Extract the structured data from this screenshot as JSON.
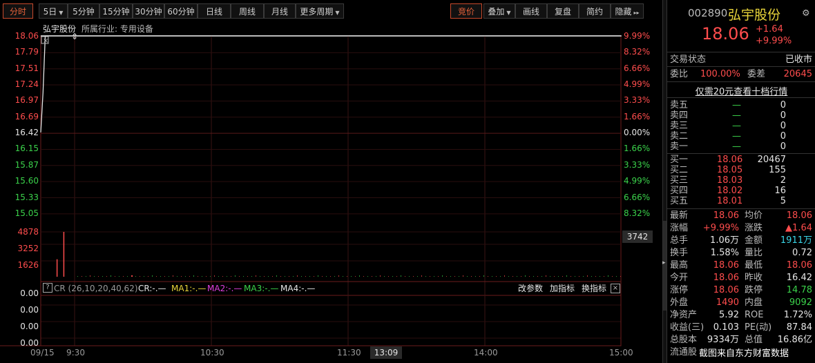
{
  "toolbar": {
    "tabs": [
      "分时",
      "5日",
      "5分钟",
      "15分钟",
      "30分钟",
      "60分钟",
      "日线",
      "周线",
      "月线",
      "更多周期"
    ],
    "right": [
      "竞价",
      "叠加",
      "画线",
      "复盘",
      "简约",
      "隐藏"
    ],
    "more_arrow": "▸▸"
  },
  "chart": {
    "stock_name": "弘宇股份",
    "industry": "所属行业: 专用设备",
    "price_labels": [
      "18.06",
      "17.79",
      "17.51",
      "17.24",
      "16.97",
      "16.69",
      "16.42",
      "16.15",
      "15.87",
      "15.60",
      "15.33",
      "15.05"
    ],
    "pct_labels": [
      "9.99%",
      "8.32%",
      "6.66%",
      "4.99%",
      "3.33%",
      "1.66%",
      "0.00%",
      "1.66%",
      "3.33%",
      "4.99%",
      "6.66%",
      "8.32%"
    ],
    "vol_labels": [
      "4878",
      "3252",
      "1626"
    ],
    "vol_marker": "3742",
    "indicator": {
      "name": "CR (26,10,20,40,62)",
      "cr": "CR:-.—",
      "ma1": "MA1:-.—",
      "ma2": "MA2:-.—",
      "ma3": "MA3:-.—",
      "ma4": "MA4:-.—",
      "actions": [
        "改参数",
        "加指标",
        "换指标"
      ],
      "y_labels": [
        "0.00",
        "0.00",
        "0.00",
        "0.00",
        "0.00"
      ]
    },
    "x_labels": [
      "09/15",
      "9:30",
      "10:30",
      "11:30",
      "13:09",
      "14:00",
      "15:00"
    ],
    "colors": {
      "up": "#ff4d4d",
      "down": "#3bd34b",
      "ma2": "#e040e0",
      "ma1": "#e8d43a"
    }
  },
  "chart_data": {
    "type": "line",
    "title": "弘宇股份",
    "ylim": [
      15.05,
      18.06
    ],
    "price_line": [
      {
        "x": "09:15",
        "y": 16.42
      },
      {
        "x": "09:16",
        "y": 17.1
      },
      {
        "x": "09:17",
        "y": 18.06
      },
      {
        "x": "15:00",
        "y": 18.06
      }
    ],
    "volume": [
      {
        "x": "09:22",
        "v": 1900
      },
      {
        "x": "09:25",
        "v": 4878
      },
      {
        "x": "09:55",
        "v": 150
      }
    ]
  },
  "quote": {
    "code": "002890",
    "name": "弘宇股份",
    "price": "18.06",
    "change": "+1.64",
    "pct": "+9.99%",
    "status_label": "交易状态",
    "status_value": "已收市",
    "weibi_label": "委比",
    "weibi_value": "100.00%",
    "weicha_label": "委差",
    "weicha_value": "20645",
    "link": "仅需20元查看十档行情",
    "asks": [
      {
        "label": "卖五",
        "price": "—",
        "vol": "0"
      },
      {
        "label": "卖四",
        "price": "—",
        "vol": "0"
      },
      {
        "label": "卖三",
        "price": "—",
        "vol": "0"
      },
      {
        "label": "卖二",
        "price": "—",
        "vol": "0"
      },
      {
        "label": "卖一",
        "price": "—",
        "vol": "0"
      }
    ],
    "bids": [
      {
        "label": "买一",
        "price": "18.06",
        "vol": "20467"
      },
      {
        "label": "买二",
        "price": "18.05",
        "vol": "155"
      },
      {
        "label": "买三",
        "price": "18.03",
        "vol": "2"
      },
      {
        "label": "买四",
        "price": "18.02",
        "vol": "16"
      },
      {
        "label": "买五",
        "price": "18.01",
        "vol": "5"
      }
    ],
    "stats": [
      {
        "l1": "最新",
        "v1": "18.06",
        "c1": "red",
        "l2": "均价",
        "v2": "18.06",
        "c2": "red"
      },
      {
        "l1": "涨幅",
        "v1": "+9.99%",
        "c1": "red",
        "l2": "涨跌",
        "v2": "▲1.64",
        "c2": "red"
      },
      {
        "l1": "总手",
        "v1": "1.06万",
        "c1": "white",
        "l2": "金额",
        "v2": "1911万",
        "c2": "cyan"
      },
      {
        "l1": "换手",
        "v1": "1.58%",
        "c1": "white",
        "l2": "量比",
        "v2": "0.72",
        "c2": "white"
      },
      {
        "l1": "最高",
        "v1": "18.06",
        "c1": "red",
        "l2": "最低",
        "v2": "18.06",
        "c2": "red"
      },
      {
        "l1": "今开",
        "v1": "18.06",
        "c1": "red",
        "l2": "昨收",
        "v2": "16.42",
        "c2": "white"
      },
      {
        "l1": "涨停",
        "v1": "18.06",
        "c1": "red",
        "l2": "跌停",
        "v2": "14.78",
        "c2": "green"
      },
      {
        "l1": "外盘",
        "v1": "1490",
        "c1": "red",
        "l2": "内盘",
        "v2": "9092",
        "c2": "green"
      },
      {
        "l1": "净资产",
        "v1": "5.92",
        "c1": "white",
        "l2": "ROE",
        "v2": "1.72%",
        "c2": "white"
      },
      {
        "l1": "收益(三)",
        "v1": "0.103",
        "c1": "white",
        "l2": "PE(动)",
        "v2": "87.84",
        "c2": "white"
      },
      {
        "l1": "总股本",
        "v1": "9334万",
        "c1": "white",
        "l2": "总值",
        "v2": "16.86亿",
        "c2": "white"
      },
      {
        "l1": "流通股",
        "v1": "",
        "c1": "white",
        "l2": "",
        "v2": "",
        "c2": "white"
      }
    ],
    "watermark": "截图来自东方财富数据"
  }
}
